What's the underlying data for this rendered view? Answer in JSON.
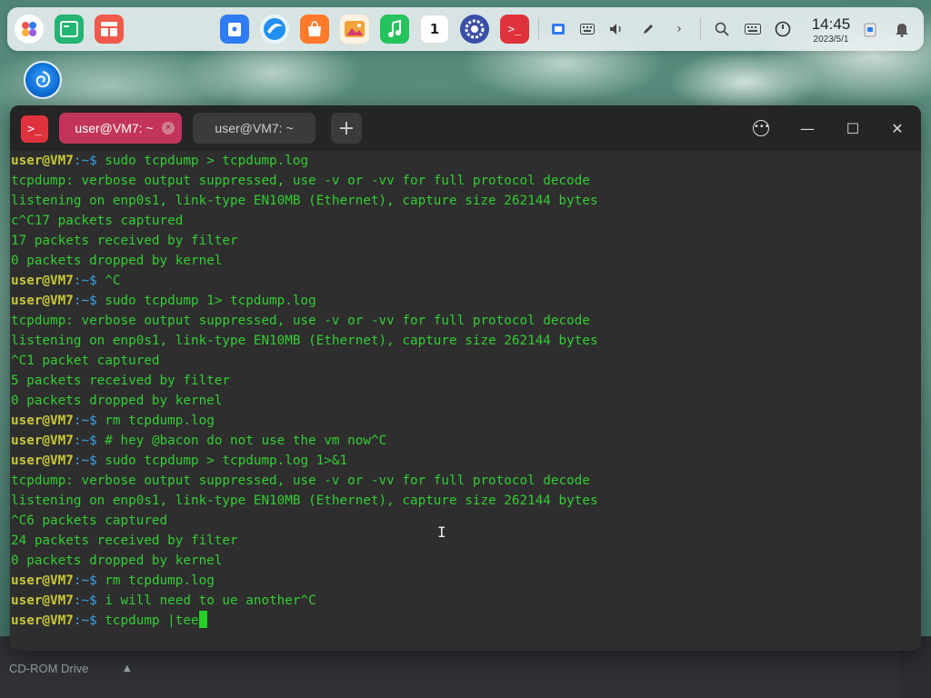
{
  "dock": {
    "apps": [
      {
        "name": "launcher",
        "icon": "launcher-icon",
        "color": "#ffffff"
      },
      {
        "name": "multitask-view",
        "icon": "multitask-icon",
        "color": "#22b573"
      },
      {
        "name": "workspace",
        "icon": "workspace-icon",
        "color": "#f05a4a"
      },
      {
        "name": "file-manager",
        "icon": "file-manager-icon",
        "color": "#2f7bf2"
      },
      {
        "name": "browser",
        "icon": "browser-icon",
        "color": "#1f8ff0"
      },
      {
        "name": "app-store",
        "icon": "store-icon",
        "color": "#ff7a2a"
      },
      {
        "name": "image-viewer",
        "icon": "image-icon",
        "color": "#f2a33a"
      },
      {
        "name": "music",
        "icon": "music-icon",
        "color": "#25c35d"
      },
      {
        "name": "calendar",
        "icon": "calendar-icon",
        "color": "#ffffff",
        "label": "1"
      },
      {
        "name": "control-center",
        "icon": "settings-icon",
        "color": "#3a4fa8"
      },
      {
        "name": "terminal",
        "icon": "terminal-icon",
        "color": "#e0323c"
      }
    ],
    "clock_time": "14:45",
    "clock_date": "2023/5/1"
  },
  "desktop": {
    "bottom_label": "CD-ROM Drive"
  },
  "terminal": {
    "app_icon_label": ">_",
    "tabs": [
      {
        "label": "user@VM7: ~",
        "active": true,
        "close": "×"
      },
      {
        "label": "user@VM7: ~",
        "active": false
      }
    ],
    "add_tab_label": "+",
    "controls": {
      "more": "•••",
      "minimize": "—",
      "maximize": "☐",
      "close": "✕"
    },
    "prompt_user": "user@VM7",
    "prompt_path": ":~$",
    "lines": [
      {
        "prompt": true,
        "text": " sudo tcpdump > tcpdump.log"
      },
      {
        "prompt": false,
        "text": "tcpdump: verbose output suppressed, use -v or -vv for full protocol decode"
      },
      {
        "prompt": false,
        "text": "listening on enp0s1, link-type EN10MB (Ethernet), capture size 262144 bytes"
      },
      {
        "prompt": false,
        "text": "c^C17 packets captured"
      },
      {
        "prompt": false,
        "text": "17 packets received by filter"
      },
      {
        "prompt": false,
        "text": "0 packets dropped by kernel"
      },
      {
        "prompt": true,
        "text": " ^C"
      },
      {
        "prompt": true,
        "text": " sudo tcpdump 1> tcpdump.log"
      },
      {
        "prompt": false,
        "text": "tcpdump: verbose output suppressed, use -v or -vv for full protocol decode"
      },
      {
        "prompt": false,
        "text": "listening on enp0s1, link-type EN10MB (Ethernet), capture size 262144 bytes"
      },
      {
        "prompt": false,
        "text": "^C1 packet captured"
      },
      {
        "prompt": false,
        "text": "5 packets received by filter"
      },
      {
        "prompt": false,
        "text": "0 packets dropped by kernel"
      },
      {
        "prompt": true,
        "text": " rm tcpdump.log"
      },
      {
        "prompt": true,
        "text": " # hey @bacon do not use the vm now^C"
      },
      {
        "prompt": true,
        "text": " sudo tcpdump > tcpdump.log 1>&1"
      },
      {
        "prompt": false,
        "text": "tcpdump: verbose output suppressed, use -v or -vv for full protocol decode"
      },
      {
        "prompt": false,
        "text": "listening on enp0s1, link-type EN10MB (Ethernet), capture size 262144 bytes"
      },
      {
        "prompt": false,
        "text": "^C6 packets captured"
      },
      {
        "prompt": false,
        "text": "24 packets received by filter"
      },
      {
        "prompt": false,
        "text": "0 packets dropped by kernel"
      },
      {
        "prompt": true,
        "text": " rm tcpdump.log"
      },
      {
        "prompt": true,
        "text": " i will need to ue another^C"
      },
      {
        "prompt": true,
        "text": " tcpdump |tee",
        "cursor": true
      }
    ]
  }
}
